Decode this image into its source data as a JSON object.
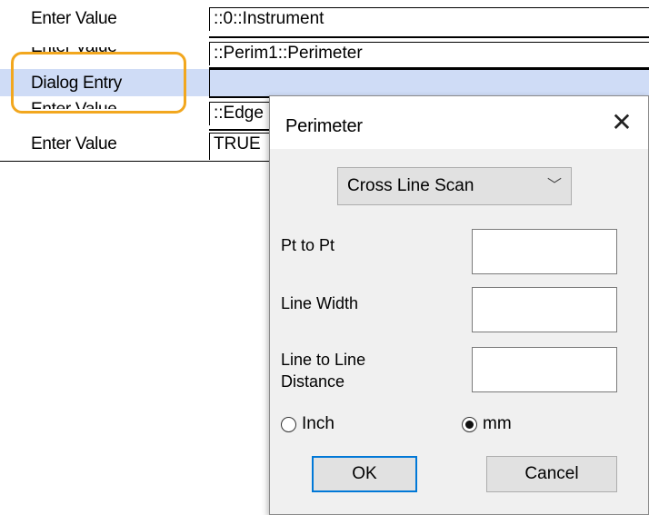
{
  "grid": {
    "rows": [
      {
        "label": "Enter Value",
        "value": "::0::Instrument"
      },
      {
        "label": "Enter Value",
        "value": "::Perim1::Perimeter"
      },
      {
        "label": "Dialog Entry",
        "value": ""
      },
      {
        "label": "Enter Value",
        "value": "::Edge"
      },
      {
        "label": "Enter Value",
        "value": "TRUE"
      }
    ],
    "selected_row_color": "#cfdcf6",
    "callout_color": "#f2a71e"
  },
  "dialog": {
    "title": "Perimeter",
    "close_icon": "close-icon",
    "scan_mode": {
      "selected": "Cross Line Scan"
    },
    "fields": {
      "pt_to_pt": {
        "label": "Pt to Pt",
        "value": ""
      },
      "line_width": {
        "label": "Line Width",
        "value": ""
      },
      "line_to_line": {
        "label_line1": "Line to Line",
        "label_line2": "Distance",
        "value": ""
      }
    },
    "units": {
      "inch": {
        "label": "Inch",
        "checked": false
      },
      "mm": {
        "label": "mm",
        "checked": true
      }
    },
    "buttons": {
      "ok": "OK",
      "cancel": "Cancel"
    },
    "accent_color": "#0078d7"
  }
}
